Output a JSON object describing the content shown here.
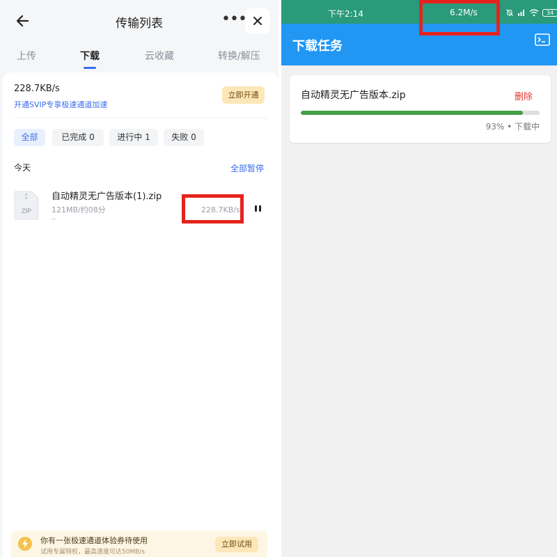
{
  "left": {
    "header": {
      "title": "传输列表",
      "back_icon": "arrow-left-icon",
      "more_label": "•••",
      "close_icon": "close-icon"
    },
    "tabs": [
      {
        "label": "上传",
        "active": false
      },
      {
        "label": "下载",
        "active": true
      },
      {
        "label": "云收藏",
        "active": false
      },
      {
        "label": "转换/解压",
        "active": false
      }
    ],
    "speed": {
      "current": "228.7KB/s",
      "svip_link": "开通SVIP专享极速通道加速",
      "open_button": "立即开通"
    },
    "filters": [
      {
        "label": "全部",
        "active": true
      },
      {
        "label": "已完成 0",
        "active": false
      },
      {
        "label": "进行中 1",
        "active": false
      },
      {
        "label": "失败 0",
        "active": false
      }
    ],
    "section": {
      "title": "今天",
      "pause_all": "全部暂停"
    },
    "file": {
      "icon_label": "ZIP",
      "name": "自动精灵无广告版本(1).zip",
      "meta": "121MB/约08分",
      "speed": "228.7KB/s"
    },
    "promo": {
      "text": "你有一张极速通道体验券待使用",
      "subtext": "试用专属特权，最高速度可达50MB/s",
      "button": "立即试用"
    }
  },
  "right": {
    "status_bar": {
      "time": "下午2:14",
      "speed": "6.2M/s",
      "battery": "34"
    },
    "appbar": {
      "title": "下载任务",
      "terminal_icon": "terminal-icon"
    },
    "task": {
      "name": "自动精灵无广告版本.zip",
      "delete_label": "删除",
      "progress": 0.93,
      "status_text": "93% • 下载中"
    }
  },
  "colors": {
    "accent_blue": "#3a6cf0",
    "appbar_blue": "#2196f3",
    "status_green": "#2a9a7a",
    "progress_green": "#43a047",
    "delete_red": "#e53935",
    "highlight_red": "#e5231e"
  }
}
